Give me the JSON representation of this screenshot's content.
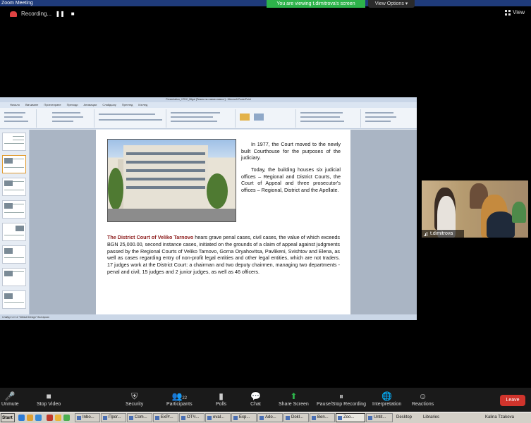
{
  "window": {
    "title": "Zoom Meeting"
  },
  "banner": {
    "viewing": "You are viewing t.dimitrova's screen",
    "view_options": "View Options",
    "view_options_caret": "▾"
  },
  "recording": {
    "label": "Recording...",
    "pause_glyph": "❚❚",
    "stop_glyph": "■"
  },
  "view": {
    "label": "View"
  },
  "powerpoint": {
    "window_title": "Presentation_VTDC_Bilgal [Режим на съвместимост] - Microsoft PowerPoint",
    "tabs": [
      "Начало",
      "Вмъкване",
      "Проектиране",
      "Преходи",
      "Анимации",
      "Слайдшоу",
      "Преглед",
      "Изглед"
    ],
    "status": "Слайд 2 от 12   \"Default Design\"   български"
  },
  "slide": {
    "p1": "In 1977, the Court moved to the newly built Courthouse for the purposes of the judiciary.",
    "p2": "Today, the building houses six judicial offices – Regional and District Courts, the Court of Appeal and three prosecutor's offices – Regional, District and the Apellate.",
    "p3_lead": "The District Court of Veliko Tarnovo",
    "p3_body": " hears grave penal cases, civil cases, the value of which exceeds BGN 25,000.00, second instance cases, initiated on the grounds of a claim of appeal against judgments passed by the Regional Courts of Veliko Tarnovo, Gorna Oryahovitsa, Pavlikeni, Svishtov and Elena, as well as cases regarding entry of non-profit legal entities and other legal entities, which are not traders. 17 judges work at the District Court: a chairman and two deputy chairmen, managing two departments - penal and civil, 15 judges and 2 junior judges, as well as 46 officers."
  },
  "participant": {
    "name": "t.dimitrova"
  },
  "toolbar": {
    "unmute": "Unmute",
    "stop_video": "Stop Video",
    "security": "Security",
    "participants": "Participants",
    "participants_count": "22",
    "polls": "Polls",
    "chat": "Chat",
    "share_screen": "Share Screen",
    "pause_stop_recording": "Pause/Stop Recording",
    "interpretation": "Interpretation",
    "reactions": "Reactions",
    "leave": "Leave"
  },
  "taskbar": {
    "start": "Start",
    "tasks": [
      "Inbo...",
      "Прог...",
      "Com...",
      "ExPr...",
      "ОТЧ...",
      "eval...",
      "Exp...",
      "Ado...",
      "Dokl...",
      "Ben...",
      "Zoo...",
      "Untit..."
    ],
    "desktop": "Desktop",
    "libraries": "Libraries",
    "user": "Kalina Tzakova"
  }
}
